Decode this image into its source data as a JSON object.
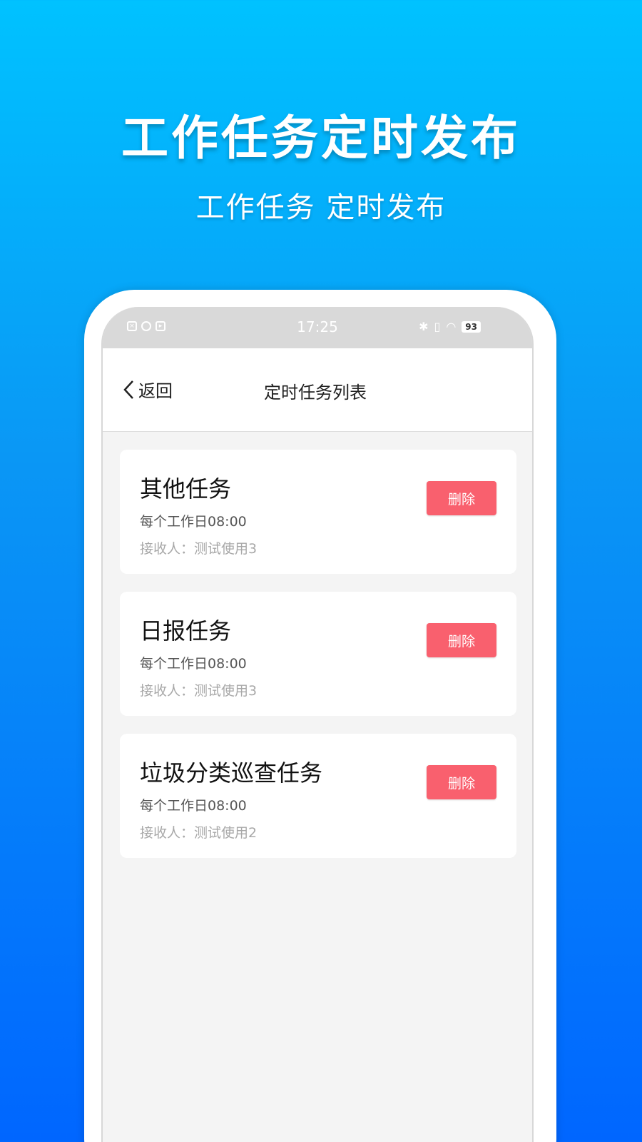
{
  "headline": "工作任务定时发布",
  "subheadline": "工作任务 定时发布",
  "status_bar": {
    "time": "17:25",
    "battery": "93"
  },
  "nav": {
    "back_label": "返回",
    "title": "定时任务列表"
  },
  "tasks": [
    {
      "title": "其他任务",
      "schedule": "每个工作日08:00",
      "recipient": "接收人：测试使用3",
      "delete_label": "删除"
    },
    {
      "title": "日报任务",
      "schedule": "每个工作日08:00",
      "recipient": "接收人：测试使用3",
      "delete_label": "删除"
    },
    {
      "title": "垃圾分类巡查任务",
      "schedule": "每个工作日08:00",
      "recipient": "接收人：测试使用2",
      "delete_label": "删除"
    }
  ],
  "colors": {
    "delete_button": "#f9606e",
    "gradient_top": "#00c2ff",
    "gradient_bottom": "#0066ff"
  }
}
